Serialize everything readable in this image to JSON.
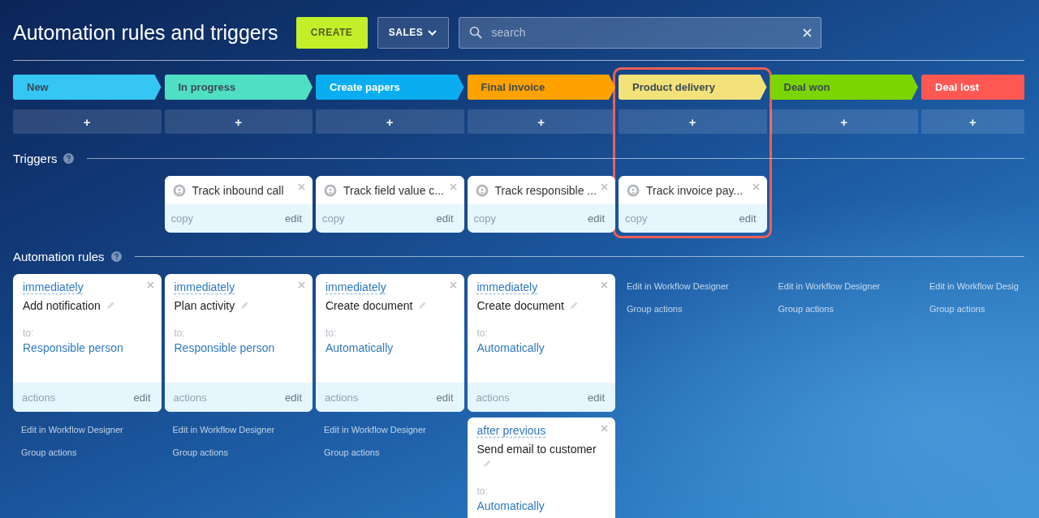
{
  "title": "Automation rules and triggers",
  "create_button": "CREATE",
  "pipeline_button": "SALES",
  "search": {
    "placeholder": "search"
  },
  "triggers_heading": "Triggers",
  "rules_heading": "Automation rules",
  "stages": [
    {
      "name": "New",
      "color": "#35c6f4",
      "highlighted": false,
      "add": "+",
      "rules": [
        {
          "timing": "immediately",
          "name": "Add notification",
          "to": "to:",
          "recipient": "Responsible person",
          "actions": "actions",
          "edit": "edit"
        }
      ],
      "links": [
        "Edit in Workflow Designer",
        "Group actions"
      ]
    },
    {
      "name": "In progress",
      "color": "#4fe0c4",
      "highlighted": false,
      "add": "+",
      "trigger": {
        "title": "Track inbound call",
        "copy": "copy",
        "edit": "edit"
      },
      "rules": [
        {
          "timing": "immediately",
          "name": "Plan activity",
          "to": "to:",
          "recipient": "Responsible person",
          "actions": "actions",
          "edit": "edit"
        }
      ],
      "links": [
        "Edit in Workflow Designer",
        "Group actions"
      ]
    },
    {
      "name": "Create papers",
      "color": "#0aaef0",
      "highlighted": false,
      "add": "+",
      "trigger": {
        "title": "Track field value c...",
        "copy": "copy",
        "edit": "edit"
      },
      "rules": [
        {
          "timing": "immediately",
          "name": "Create document",
          "to": "to:",
          "recipient": "Automatically",
          "actions": "actions",
          "edit": "edit"
        }
      ],
      "links": [
        "Edit in Workflow Designer",
        "Group actions"
      ]
    },
    {
      "name": "Final invoice",
      "color": "#ffa200",
      "highlighted": false,
      "add": "+",
      "trigger": {
        "title": "Track responsible ...",
        "copy": "copy",
        "edit": "edit"
      },
      "rules": [
        {
          "timing": "immediately",
          "name": "Create document",
          "to": "to:",
          "recipient": "Automatically",
          "actions": "actions",
          "edit": "edit"
        },
        {
          "timing": "after previous",
          "name": "Send email to customer",
          "to": "to:",
          "recipient": "Automatically"
        }
      ]
    },
    {
      "name": "Product delivery",
      "color": "#f3e17a",
      "highlighted": true,
      "add": "+",
      "trigger": {
        "title": "Track invoice pay...",
        "copy": "copy",
        "edit": "edit"
      },
      "links": [
        "Edit in Workflow Designer",
        "Group actions"
      ]
    },
    {
      "name": "Deal won",
      "color": "#7bd500",
      "highlighted": false,
      "add": "+",
      "links": [
        "Edit in Workflow Designer",
        "Group actions"
      ]
    },
    {
      "name": "Deal lost",
      "color": "#ff5752",
      "highlighted": false,
      "add": "+",
      "links": [
        "Edit in Workflow Desig",
        "Group actions"
      ]
    }
  ]
}
